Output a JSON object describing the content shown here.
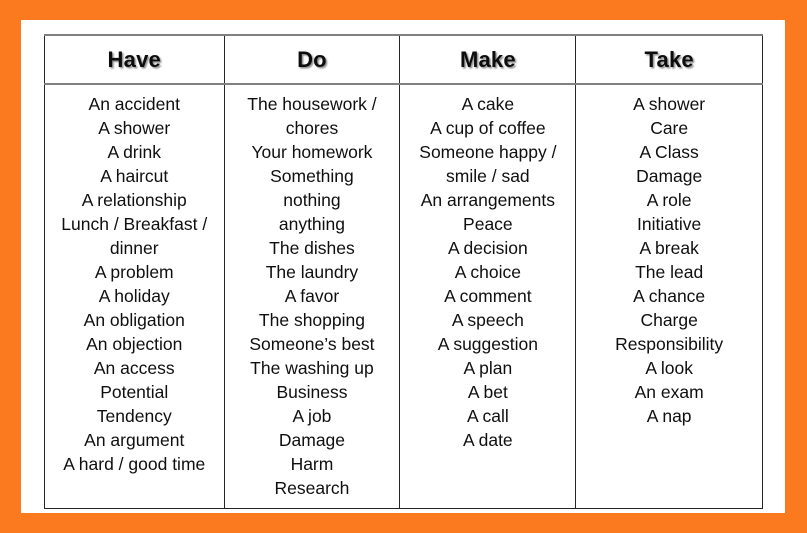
{
  "frame": {
    "border_color": "#fb7a20",
    "mat_color": "#ffffff"
  },
  "table": {
    "grid_line_color": "#262626",
    "header_rule_color": "#808080",
    "columns": [
      {
        "header": "Have",
        "items": [
          "An accident",
          "A shower",
          "A drink",
          "A haircut",
          "A relationship",
          "Lunch / Breakfast /",
          "dinner",
          "A problem",
          "A holiday",
          "An obligation",
          "An objection",
          "An access",
          "Potential",
          "Tendency",
          "An argument",
          "A hard / good time"
        ]
      },
      {
        "header": "Do",
        "items": [
          "The housework /",
          "chores",
          "Your homework",
          "Something",
          "nothing",
          "anything",
          "The dishes",
          "The laundry",
          "A favor",
          "The shopping",
          "Someone’s best",
          "The washing up",
          "Business",
          "A job",
          "Damage",
          "Harm",
          "Research"
        ]
      },
      {
        "header": "Make",
        "items": [
          "A cake",
          "A cup of coffee",
          "Someone happy /",
          "smile / sad",
          "An arrangements",
          "Peace",
          "A decision",
          "A choice",
          "A comment",
          "A speech",
          "A suggestion",
          "A plan",
          "A bet",
          "A call",
          "A date"
        ]
      },
      {
        "header": "Take",
        "items": [
          "A shower",
          "Care",
          "A Class",
          "Damage",
          "A role",
          "Initiative",
          "A break",
          "The lead",
          "A chance",
          "Charge",
          "Responsibility",
          "A look",
          "An exam",
          "A nap"
        ]
      }
    ]
  }
}
